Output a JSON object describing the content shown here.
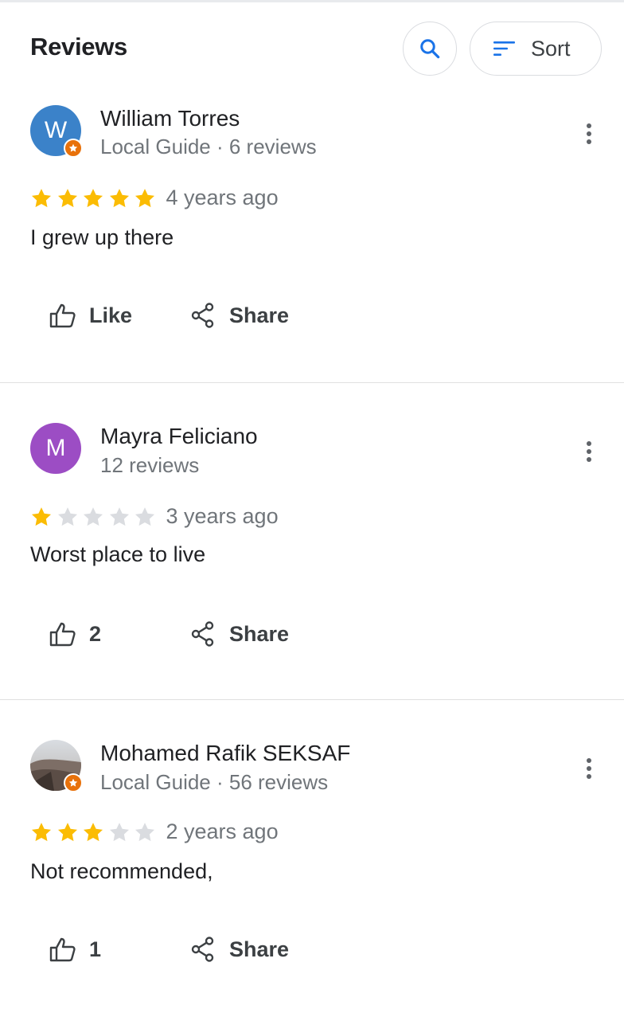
{
  "header": {
    "title": "Reviews",
    "search_icon": "search-icon",
    "sort_icon": "sort-lines-icon",
    "sort_label": "Sort"
  },
  "colors": {
    "accent_blue": "#1a73e8",
    "star_filled": "#fbbc04",
    "star_empty": "#dadce0",
    "local_guide_badge": "#e8710a"
  },
  "reviews": [
    {
      "avatar_letter": "W",
      "avatar_color": "#3b82c9",
      "local_guide": true,
      "name": "William Torres",
      "meta": "Local Guide · 6 reviews",
      "rating": 5,
      "time": "4 years ago",
      "text": "I grew up there",
      "like_label": "Like",
      "share_label": "Share"
    },
    {
      "avatar_letter": "M",
      "avatar_color": "#9c4dc4",
      "local_guide": false,
      "name": "Mayra Feliciano",
      "meta": "12 reviews",
      "rating": 1,
      "time": "3 years ago",
      "text": "Worst place to live",
      "like_label": "2",
      "share_label": "Share"
    },
    {
      "avatar_letter": "",
      "avatar_color": "#8a7f78",
      "local_guide": true,
      "name": "Mohamed Rafik SEKSAF",
      "meta": "Local Guide · 56 reviews",
      "rating": 3,
      "time": "2 years ago",
      "text": "Not recommended,",
      "like_label": "1",
      "share_label": "Share"
    }
  ]
}
